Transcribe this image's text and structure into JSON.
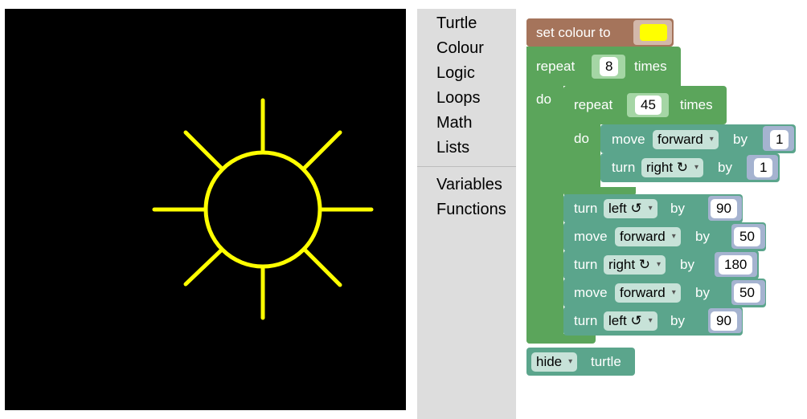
{
  "toolbox": {
    "categories": [
      "Turtle",
      "Colour",
      "Logic",
      "Loops",
      "Math",
      "Lists"
    ],
    "categories2": [
      "Variables",
      "Functions"
    ]
  },
  "drawing": {
    "stroke_color": "#ffff00",
    "background": "#000000"
  },
  "blocks": {
    "set_colour": {
      "label": "set colour to",
      "value_color": "#ffff00"
    },
    "repeat_outer": {
      "label": "repeat",
      "count": "8",
      "suffix": "times",
      "do": "do"
    },
    "repeat_inner": {
      "label": "repeat",
      "count": "45",
      "suffix": "times",
      "do": "do"
    },
    "inner_move": {
      "label": "move",
      "dir": "forward",
      "by": "by",
      "value": "1"
    },
    "inner_turn": {
      "label": "turn",
      "dir": "right ↻",
      "by": "by",
      "value": "1"
    },
    "turn1": {
      "label": "turn",
      "dir": "left ↺",
      "by": "by",
      "value": "90"
    },
    "move1": {
      "label": "move",
      "dir": "forward",
      "by": "by",
      "value": "50"
    },
    "turn2": {
      "label": "turn",
      "dir": "right ↻",
      "by": "by",
      "value": "180"
    },
    "move2": {
      "label": "move",
      "dir": "forward",
      "by": "by",
      "value": "50"
    },
    "turn3": {
      "label": "turn",
      "dir": "left ↺",
      "by": "by",
      "value": "90"
    },
    "hide": {
      "dir": "hide",
      "label": "turtle"
    }
  },
  "colors": {
    "loop_green": "#5ba55b",
    "turtle_teal": "#5ba58c",
    "colour_brown": "#a5745b",
    "socket_blue": "#a5b3d0",
    "dropdown_bg": "#c7e2d8"
  }
}
